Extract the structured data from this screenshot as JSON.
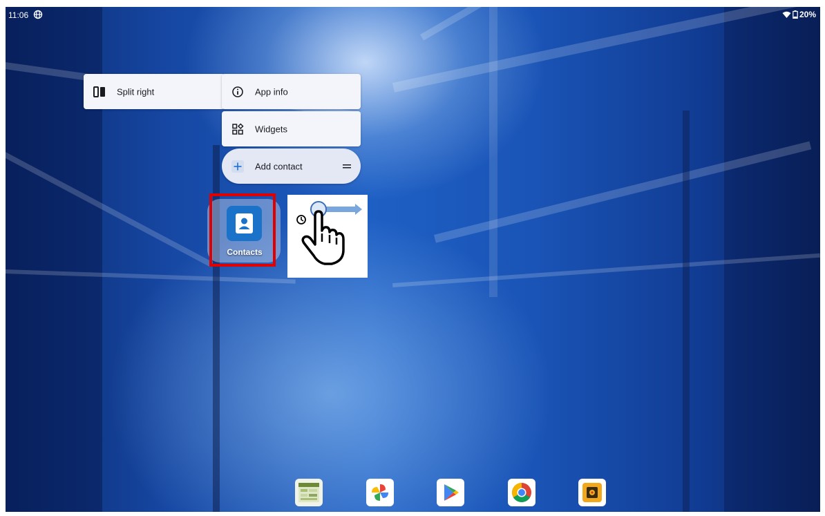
{
  "status_bar": {
    "time": "11:06",
    "battery_percent": "20%",
    "icons": [
      "vpn-globe-icon",
      "wifi-icon",
      "battery-icon"
    ]
  },
  "context_menu": {
    "split_right": {
      "label": "Split right",
      "icon": "split-screen-icon"
    },
    "app_info": {
      "label": "App info",
      "icon": "info-icon"
    },
    "widgets": {
      "label": "Widgets",
      "icon": "widgets-icon"
    },
    "add_contact": {
      "label": "Add contact",
      "icon": "plus-icon",
      "drag_icon": "drag-handle-icon"
    }
  },
  "home_app": {
    "label": "Contacts",
    "icon": "contacts-icon",
    "highlight_color": "#e00000"
  },
  "gesture_hint": {
    "icons": [
      "long-press-timer-icon",
      "hand-pointer-icon",
      "drag-right-arrow-icon"
    ]
  },
  "dock": [
    {
      "name": "dock-app-spreadsheet",
      "icon": "spreadsheet-icon"
    },
    {
      "name": "dock-app-photos",
      "icon": "google-photos-icon"
    },
    {
      "name": "dock-app-play-store",
      "icon": "play-store-icon"
    },
    {
      "name": "dock-app-chrome",
      "icon": "chrome-icon"
    },
    {
      "name": "dock-app-music",
      "icon": "music-player-icon"
    }
  ],
  "colors": {
    "wallpaper_primary": "#1e5fc4",
    "menu_background": "#f3f5fb",
    "highlight": "#e00000",
    "contacts_accent": "#1a73c8"
  }
}
